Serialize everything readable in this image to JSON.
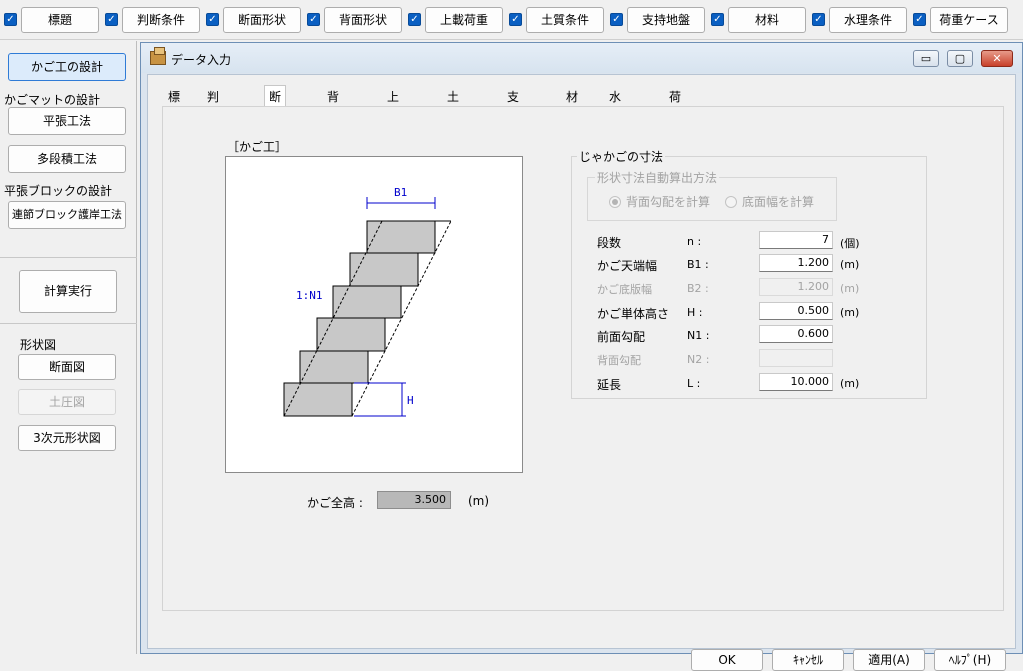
{
  "toolbar": {
    "items": [
      {
        "label": "標題",
        "checked": true
      },
      {
        "label": "判断条件",
        "checked": true
      },
      {
        "label": "断面形状",
        "checked": true
      },
      {
        "label": "背面形状",
        "checked": true
      },
      {
        "label": "上載荷重",
        "checked": true
      },
      {
        "label": "土質条件",
        "checked": true
      },
      {
        "label": "支持地盤",
        "checked": true
      },
      {
        "label": "材料",
        "checked": true
      },
      {
        "label": "水理条件",
        "checked": true
      },
      {
        "label": "荷重ケース",
        "checked": true
      }
    ]
  },
  "sidebar": {
    "kagoko": "かご工の設計",
    "mat_heading": "かごマットの設計",
    "heibari": "平張工法",
    "tadan": "多段積工法",
    "block_heading": "平張ブロックの設計",
    "renketsu": "連節ブロック護岸工法",
    "calc": "計算実行",
    "shape_heading": "形状図",
    "danmen": "断面図",
    "doatsu": "土圧図",
    "sanjigen": "3次元形状図"
  },
  "dialog": {
    "title": "データ入力",
    "min_glyph": "▭",
    "max_glyph": "▢",
    "close_glyph": "✕",
    "tabs": [
      "標題",
      "判断条件",
      "断面形状",
      "背面形状",
      "上載荷重",
      "土質条件",
      "支持地盤",
      "材料",
      "水理条件",
      "荷重ケース"
    ],
    "active_tab": "断面形状",
    "figure_label": "［かご工］",
    "figure": {
      "b1": "B1",
      "slope": "1:N1",
      "h": "H"
    },
    "total": {
      "label": "かご全高 :",
      "value": "3.500",
      "unit": "(m)"
    },
    "group_title": "じゃかごの寸法",
    "auto": {
      "title": "形状寸法自動算出方法",
      "options": [
        "背面勾配を計算",
        "底面幅を計算"
      ],
      "selected": 0
    },
    "rows": [
      {
        "label": "段数",
        "sym": "n :",
        "value": "7",
        "unit": "(個)",
        "enabled": true
      },
      {
        "label": "かご天端幅",
        "sym": "B1 :",
        "value": "1.200",
        "unit": "(m)",
        "enabled": true
      },
      {
        "label": "かご底版幅",
        "sym": "B2 :",
        "value": "1.200",
        "unit": "(m)",
        "enabled": false
      },
      {
        "label": "かご単体高さ",
        "sym": "H :",
        "value": "0.500",
        "unit": "(m)",
        "enabled": true
      },
      {
        "label": "前面勾配",
        "sym": "N1 :",
        "value": "0.600",
        "unit": "",
        "enabled": true
      },
      {
        "label": "背面勾配",
        "sym": "N2 :",
        "value": "",
        "unit": "",
        "enabled": false
      },
      {
        "label": "延長",
        "sym": "L :",
        "value": "10.000",
        "unit": "(m)",
        "enabled": true
      }
    ],
    "buttons": {
      "ok": "OK",
      "cancel": "ｷｬﾝｾﾙ",
      "apply": "適用(A)",
      "help": "ﾍﾙﾌﾟ(H)"
    }
  }
}
